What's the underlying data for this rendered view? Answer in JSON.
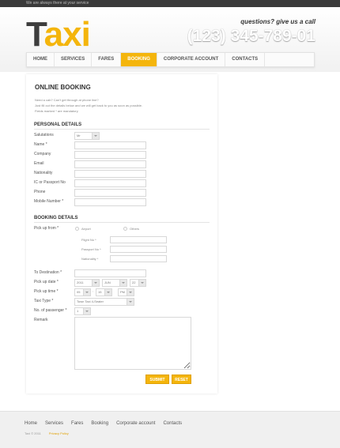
{
  "topbar": {
    "text": "We are always there at your service"
  },
  "header": {
    "logo_part1": "T",
    "logo_part2": "axi",
    "tagline": "questions? give us a call",
    "phone": "(123) 345-789-01"
  },
  "nav": {
    "items": [
      {
        "label": "Home"
      },
      {
        "label": "Services"
      },
      {
        "label": "Fares"
      },
      {
        "label": "Booking"
      },
      {
        "label": "Corporate account"
      },
      {
        "label": "Contacts"
      }
    ],
    "active": "Booking"
  },
  "form": {
    "title": "Online Booking",
    "intro": [
      "Need a cab? Can't get through at phone line?",
      "Just fill out the details below and we will get back to you as soon as possible.",
      "Fields marked * are mandatory"
    ],
    "personal": {
      "title": "Personal Details",
      "salutation_label": "Salutations",
      "salutation_value": "Mr",
      "name_label": "Name *",
      "company_label": "Company",
      "email_label": "Email",
      "nationality_label": "Nationality",
      "ic_label": "IC or Passport No",
      "phone_label": "Phone",
      "mobile_label": "Mobile Number *"
    },
    "booking": {
      "title": "Booking Details",
      "pickup_from_label": "Pick up from *",
      "airport_label": "Airport",
      "others_label": "Others",
      "flight_label": "Flight No *",
      "passport_label": "Passport No *",
      "nationality_label": "Nationality *",
      "destination_label": "To Destination *",
      "pickup_date_label": "Pick up date *",
      "date_year": "2011",
      "date_month": "JUN",
      "date_day": "22",
      "pickup_time_label": "Pick up time *",
      "time_hour": "05",
      "time_minute": "15",
      "time_ampm": "PM",
      "time_sep": ":",
      "taxi_type_label": "Taxi Type *",
      "taxi_type_value": "Town Taxi 4-Seater",
      "passengers_label": "No. of passenger *",
      "passengers_value": "1",
      "remark_label": "Remark"
    },
    "submit_label": "Submit",
    "reset_label": "Reset"
  },
  "footer": {
    "links": [
      {
        "label": "Home"
      },
      {
        "label": "Services"
      },
      {
        "label": "Fares"
      },
      {
        "label": "Booking"
      },
      {
        "label": "Corporate account"
      },
      {
        "label": "Contacts"
      }
    ],
    "copyright": "Taxi © 2011",
    "privacy": "Privacy Policy"
  },
  "colors": {
    "accent": "#f4b50c",
    "dark": "#3d3d3d"
  }
}
